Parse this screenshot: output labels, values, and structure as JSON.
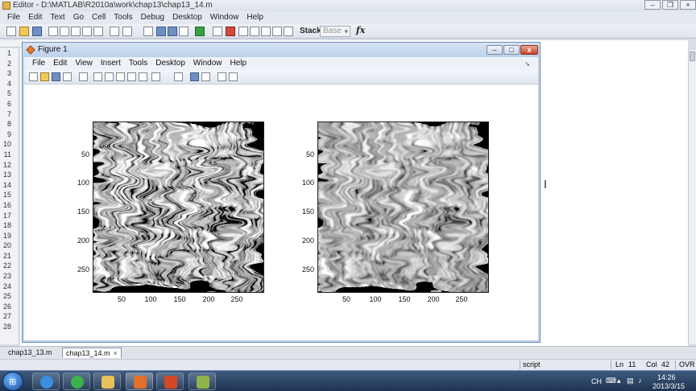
{
  "editor": {
    "title": "Editor - D:\\MATLAB\\R2010a\\work\\chap13\\chap13_14.m",
    "menu": [
      "File",
      "Edit",
      "Text",
      "Go",
      "Cell",
      "Tools",
      "Debug",
      "Desktop",
      "Window",
      "Help"
    ],
    "toolbar": {
      "stack_label": "Stack:",
      "stack_value": "Base",
      "fx": "fx"
    },
    "line_numbers": [
      "1",
      "2",
      "3",
      "4",
      "5",
      "6",
      "7",
      "8",
      "9",
      "10",
      "11",
      "12",
      "13",
      "14",
      "15",
      "16",
      "17",
      "18",
      "19",
      "20",
      "21",
      "22",
      "23",
      "24",
      "25",
      "26",
      "27",
      "28"
    ],
    "tabs": [
      {
        "label": "chap13_13.m",
        "active": false
      },
      {
        "label": "chap13_14.m",
        "active": true
      }
    ],
    "tab_close": "×",
    "status": {
      "mode": "script",
      "ln_label": "Ln",
      "ln": "11",
      "col_label": "Col",
      "col": "42",
      "ovr": "OVR"
    }
  },
  "figure": {
    "title": "Figure 1",
    "menu": [
      "File",
      "Edit",
      "View",
      "Insert",
      "Tools",
      "Desktop",
      "Window",
      "Help"
    ],
    "window_buttons": {
      "minimize": "–",
      "maximize": "□",
      "close": "x"
    },
    "axes": [
      {
        "image": "fingerprint-original",
        "yticks": [
          "50",
          "100",
          "150",
          "200",
          "250"
        ],
        "xticks": [
          "50",
          "100",
          "150",
          "200",
          "250"
        ]
      },
      {
        "image": "fingerprint-smoothed",
        "yticks": [
          "50",
          "100",
          "150",
          "200",
          "250"
        ],
        "xticks": [
          "50",
          "100",
          "150",
          "200",
          "250"
        ]
      }
    ]
  },
  "taskbar": {
    "apps": [
      "internet-explorer",
      "refresh-app",
      "file-explorer",
      "matlab",
      "powerpoint",
      "green-app"
    ],
    "tray": {
      "ime": "CH",
      "time": "14:26",
      "date": "2013/3/15"
    }
  },
  "colors": {
    "figure_frame": "#c2d4ea",
    "taskbar": "#1f3452",
    "editor_bg": "#ffffff"
  }
}
